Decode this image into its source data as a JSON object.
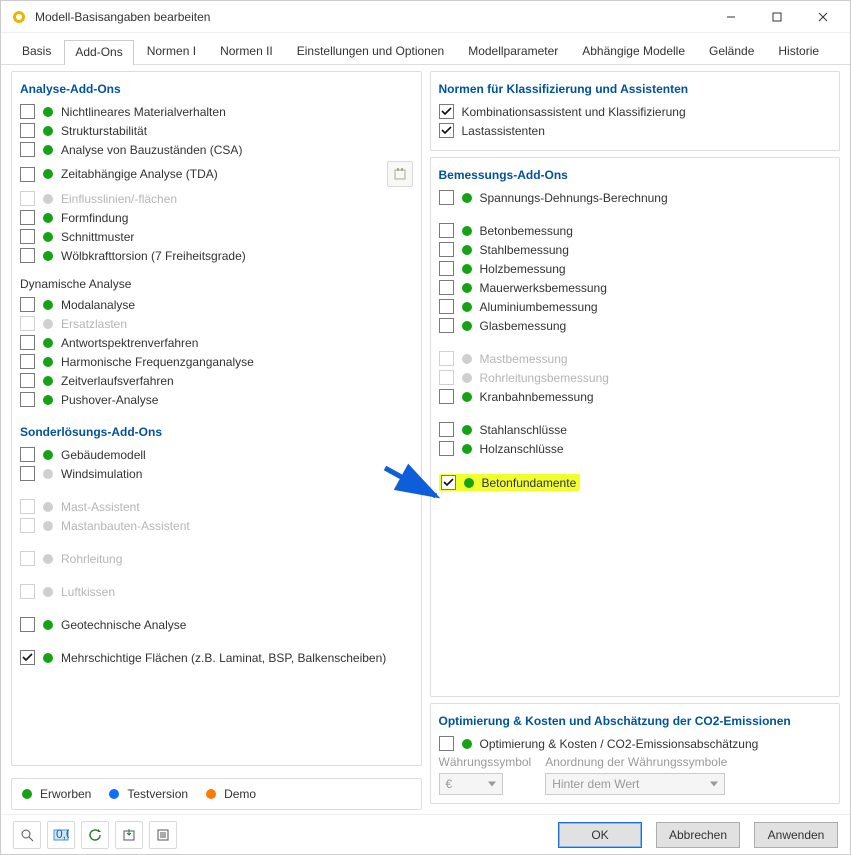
{
  "window": {
    "title": "Modell-Basisangaben bearbeiten"
  },
  "tabs": [
    "Basis",
    "Add-Ons",
    "Normen I",
    "Normen II",
    "Einstellungen und Optionen",
    "Modellparameter",
    "Abhängige Modelle",
    "Gelände",
    "Historie"
  ],
  "active_tab": 1,
  "left": {
    "analysis_title": "Analyse-Add-Ons",
    "items_a": [
      {
        "label": "Nichtlineares Materialverhalten",
        "status": "green",
        "checked": false,
        "disabled": false
      },
      {
        "label": "Strukturstabilität",
        "status": "green",
        "checked": false,
        "disabled": false
      },
      {
        "label": "Analyse von Bauzuständen (CSA)",
        "status": "green",
        "checked": false,
        "disabled": false
      },
      {
        "label": "Zeitabhängige Analyse (TDA)",
        "status": "green",
        "checked": false,
        "disabled": false,
        "has_side_btn": true
      },
      {
        "label": "Einflusslinien/-flächen",
        "status": "gray",
        "checked": false,
        "disabled": true
      },
      {
        "label": "Formfindung",
        "status": "green",
        "checked": false,
        "disabled": false
      },
      {
        "label": "Schnittmuster",
        "status": "green",
        "checked": false,
        "disabled": false
      },
      {
        "label": "Wölbkrafttorsion (7 Freiheitsgrade)",
        "status": "green",
        "checked": false,
        "disabled": false
      }
    ],
    "dynamic_title": "Dynamische Analyse",
    "items_b": [
      {
        "label": "Modalanalyse",
        "status": "green",
        "checked": false,
        "disabled": false
      },
      {
        "label": "Ersatzlasten",
        "status": "gray",
        "checked": false,
        "disabled": true
      },
      {
        "label": "Antwortspektrenverfahren",
        "status": "green",
        "checked": false,
        "disabled": false
      },
      {
        "label": "Harmonische Frequenzganganalyse",
        "status": "green",
        "checked": false,
        "disabled": false
      },
      {
        "label": "Zeitverlaufsverfahren",
        "status": "green",
        "checked": false,
        "disabled": false
      },
      {
        "label": "Pushover-Analyse",
        "status": "green",
        "checked": false,
        "disabled": false
      }
    ],
    "special_title": "Sonderlösungs-Add-Ons",
    "items_c": [
      {
        "label": "Gebäudemodell",
        "status": "green",
        "checked": false,
        "disabled": false
      },
      {
        "label": "Windsimulation",
        "status": "gray",
        "checked": false,
        "disabled": false
      }
    ],
    "items_d": [
      {
        "label": "Mast-Assistent",
        "status": "gray",
        "checked": false,
        "disabled": true
      },
      {
        "label": "Mastanbauten-Assistent",
        "status": "gray",
        "checked": false,
        "disabled": true
      }
    ],
    "items_e": [
      {
        "label": "Rohrleitung",
        "status": "gray",
        "checked": false,
        "disabled": true
      }
    ],
    "items_f": [
      {
        "label": "Luftkissen",
        "status": "gray",
        "checked": false,
        "disabled": true
      }
    ],
    "items_g": [
      {
        "label": "Geotechnische Analyse",
        "status": "green",
        "checked": false,
        "disabled": false
      }
    ],
    "items_h": [
      {
        "label": "Mehrschichtige Flächen (z.B. Laminat, BSP, Balkenscheiben)",
        "status": "green",
        "checked": true,
        "disabled": false
      }
    ]
  },
  "right": {
    "norms_title": "Normen für Klassifizierung und Assistenten",
    "norms": [
      {
        "label": "Kombinationsassistent und Klassifizierung",
        "checked": true
      },
      {
        "label": "Lastassistenten",
        "checked": true
      }
    ],
    "design_title": "Bemessungs-Add-Ons",
    "design_a": [
      {
        "label": "Spannungs-Dehnungs-Berechnung",
        "status": "green",
        "checked": false,
        "disabled": false
      }
    ],
    "design_b": [
      {
        "label": "Betonbemessung",
        "status": "green",
        "checked": false,
        "disabled": false
      },
      {
        "label": "Stahlbemessung",
        "status": "green",
        "checked": false,
        "disabled": false
      },
      {
        "label": "Holzbemessung",
        "status": "green",
        "checked": false,
        "disabled": false
      },
      {
        "label": "Mauerwerksbemessung",
        "status": "green",
        "checked": false,
        "disabled": false
      },
      {
        "label": "Aluminiumbemessung",
        "status": "green",
        "checked": false,
        "disabled": false
      },
      {
        "label": "Glasbemessung",
        "status": "green",
        "checked": false,
        "disabled": false
      }
    ],
    "design_c": [
      {
        "label": "Mastbemessung",
        "status": "gray",
        "checked": false,
        "disabled": true
      },
      {
        "label": "Rohrleitungsbemessung",
        "status": "gray",
        "checked": false,
        "disabled": true
      },
      {
        "label": "Kranbahnbemessung",
        "status": "green",
        "checked": false,
        "disabled": false
      }
    ],
    "design_d": [
      {
        "label": "Stahlanschlüsse",
        "status": "green",
        "checked": false,
        "disabled": false
      },
      {
        "label": "Holzanschlüsse",
        "status": "green",
        "checked": false,
        "disabled": false
      }
    ],
    "design_e": [
      {
        "label": "Betonfundamente",
        "status": "green",
        "checked": true,
        "disabled": false,
        "highlight": true
      }
    ],
    "opt_title": "Optimierung & Kosten und Abschätzung der CO2-Emissionen",
    "opt_label": "Optimierung & Kosten / CO2-Emissionsabschätzung",
    "opt_currency_label": "Währungssymbol",
    "opt_currency_value": "€",
    "opt_order_label": "Anordnung der Währungssymbole",
    "opt_order_value": "Hinter dem Wert"
  },
  "legend": {
    "acquired": "Erworben",
    "test": "Testversion",
    "demo": "Demo"
  },
  "buttons": {
    "ok": "OK",
    "cancel": "Abbrechen",
    "apply": "Anwenden"
  }
}
